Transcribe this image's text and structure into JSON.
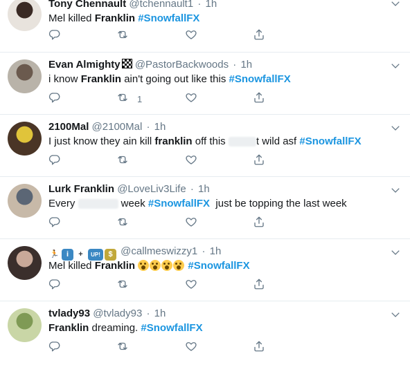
{
  "feed": {
    "tweets": [
      {
        "name": "Tony Chennault",
        "handle": "@tchennault1",
        "time": "1h",
        "text_parts": [
          {
            "t": "Mel killed "
          },
          {
            "t": "Franklin",
            "bold": true
          },
          {
            "t": " "
          },
          {
            "t": "#SnowfallFX",
            "tag": true
          }
        ],
        "retweet_count": "",
        "avatar_colors": [
          "#3a2a24",
          "#e8e3dd"
        ]
      },
      {
        "name": "Evan Almighty",
        "handle": "@PastorBackwoods",
        "time": "1h",
        "text_parts": [
          {
            "t": "i know "
          },
          {
            "t": "Franklin",
            "bold": true
          },
          {
            "t": " ain't going out like this "
          },
          {
            "t": "#SnowfallFX",
            "tag": true
          }
        ],
        "retweet_count": "1",
        "avatar_colors": [
          "#6b5a4e",
          "#b9b3a9"
        ]
      },
      {
        "name": "2100Mal",
        "handle": "@2100Mal",
        "time": "1h",
        "text_parts": [
          {
            "t": "I just know they ain kill "
          },
          {
            "t": "franklin",
            "bold": true
          },
          {
            "t": " off this "
          },
          {
            "blur": 40
          },
          {
            "t": "t wild asf "
          },
          {
            "t": "#SnowfallFX",
            "tag": true
          }
        ],
        "retweet_count": "",
        "avatar_colors": [
          "#e0c43a",
          "#4a3526"
        ]
      },
      {
        "name": "Lurk Franklin",
        "handle": "@LoveLiv3Life",
        "time": "1h",
        "text_parts": [
          {
            "t": "Every "
          },
          {
            "blur": 58
          },
          {
            "t": " week "
          },
          {
            "t": "#SnowfallFX",
            "tag": true
          },
          {
            "t": "  just be topping the last week"
          }
        ],
        "retweet_count": "",
        "avatar_colors": [
          "#5b6675",
          "#c7b9a8"
        ]
      },
      {
        "name": "",
        "name_emojis": [
          "runner",
          "info",
          "plus",
          "up",
          "money"
        ],
        "handle": "@callmeswizzy1",
        "time": "1h",
        "text_parts": [
          {
            "t": "Mel killed "
          },
          {
            "t": "Franklin",
            "bold": true
          },
          {
            "t": " "
          },
          {
            "emoji_faces": 4
          },
          {
            "t": " "
          },
          {
            "t": "#SnowfallFX",
            "tag": true
          }
        ],
        "retweet_count": "",
        "avatar_colors": [
          "#c9a999",
          "#3b2f2c"
        ]
      },
      {
        "name": "tvlady93",
        "handle": "@tvlady93",
        "time": "1h",
        "text_parts": [
          {
            "t": "Franklin",
            "bold": true
          },
          {
            "t": " dreaming. "
          },
          {
            "t": "#SnowfallFX",
            "tag": true
          }
        ],
        "retweet_count": "",
        "avatar_colors": [
          "#7f9a55",
          "#c9d6a6"
        ]
      }
    ],
    "separator": "·",
    "colors": {
      "hashtag": "#1b95e0",
      "muted": "#657786",
      "border": "#e6ecf0"
    },
    "icons": [
      "reply-icon",
      "retweet-icon",
      "like-icon",
      "share-icon",
      "chevron-down-icon"
    ]
  }
}
